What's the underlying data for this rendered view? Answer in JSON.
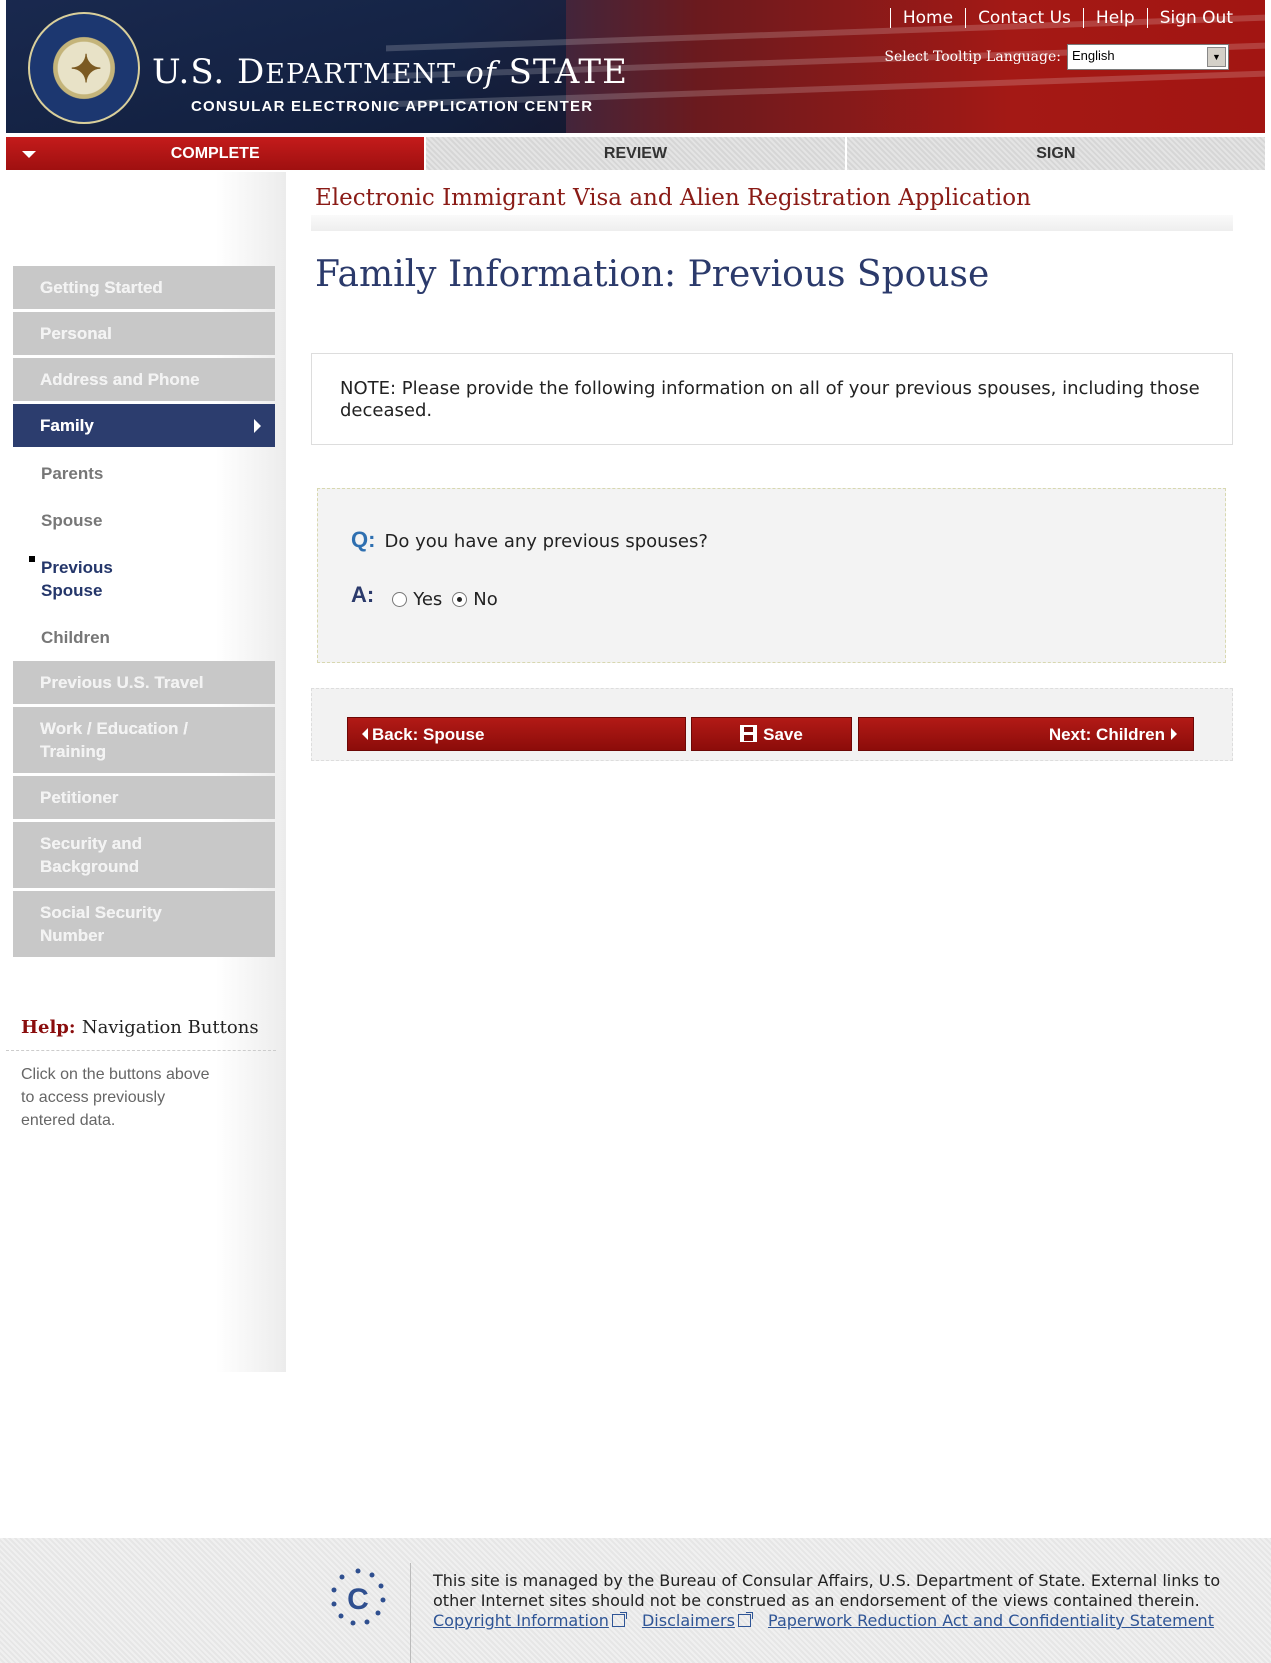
{
  "header": {
    "dept_name_pre": "U.S. D",
    "dept_name_mid": "EPARTMENT ",
    "dept_name_of": "of",
    "dept_name_post": " STATE",
    "dept_subtitle": "CONSULAR ELECTRONIC APPLICATION CENTER",
    "top_links": [
      "Home",
      "Contact Us",
      "Help",
      "Sign Out"
    ],
    "tooltip_label": "Select Tooltip Language:",
    "tooltip_value": "English",
    "colors": {
      "header_red": "#a41915",
      "header_navy": "#132141"
    }
  },
  "steps": [
    {
      "label": "COMPLETE",
      "active": true
    },
    {
      "label": "REVIEW",
      "active": false
    },
    {
      "label": "SIGN",
      "active": false
    }
  ],
  "sidebar": {
    "items": [
      {
        "label": "Getting Started"
      },
      {
        "label": "Personal"
      },
      {
        "label": "Address and Phone"
      },
      {
        "label": "Family"
      },
      {
        "label": "Parents"
      },
      {
        "label": "Spouse"
      },
      {
        "label": "Previous Spouse"
      },
      {
        "label": "Children"
      },
      {
        "label": "Previous U.S. Travel"
      },
      {
        "label": "Work / Education / Training"
      },
      {
        "label": "Petitioner"
      },
      {
        "label": "Security and Background"
      },
      {
        "label": "Social Security Number"
      }
    ],
    "help": {
      "label": "Help:",
      "title": "Navigation Buttons",
      "text": "Click on the buttons above to access previously entered data."
    }
  },
  "main": {
    "app_title": "Electronic Immigrant Visa and Alien Registration Application",
    "page_title": "Family Information: Previous Spouse",
    "note": "NOTE: Please provide the following information on all of your previous spouses, including those deceased.",
    "question": {
      "q_prefix": "Q:",
      "q_text": "Do you have any previous spouses?",
      "a_prefix": "A:",
      "options": [
        "Yes",
        "No"
      ],
      "selected": "No"
    },
    "buttons": {
      "back": "Back: Spouse",
      "save": "Save",
      "next": "Next: Children"
    }
  },
  "footer": {
    "text": "This site is managed by the Bureau of Consular Affairs, U.S. Department of State. External links to other Internet sites should not be construed as an endorsement of the views contained therein.",
    "links": [
      "Copyright Information",
      "Disclaimers",
      "Paperwork Reduction Act and Confidentiality Statement"
    ]
  }
}
